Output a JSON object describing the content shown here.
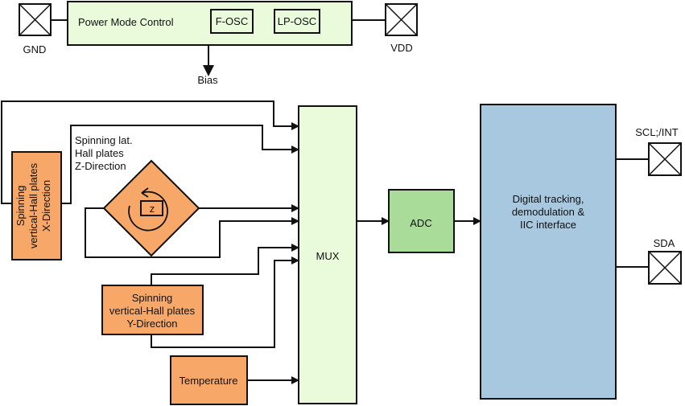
{
  "colors": {
    "power_block": "#eafbdc",
    "sensor_block": "#f7a868",
    "mux_block": "#eafbdc",
    "adc_block": "#a9dc98",
    "digital_block": "#a8c8e0",
    "line": "#111111"
  },
  "power": {
    "title": "Power Mode Control",
    "fosc": "F-OSC",
    "lposc": "LP-OSC",
    "bias": "Bias"
  },
  "pins": {
    "gnd": "GND",
    "vdd": "VDD",
    "scl": "SCL;/INT",
    "sda": "SDA"
  },
  "sensors": {
    "x_direction": [
      "Spinning",
      "vertical-Hall plates",
      "X-Direction"
    ],
    "z_direction_label": [
      "Spinning lat.",
      "Hall plates",
      "Z-Direction"
    ],
    "z_symbol": "z",
    "y_direction": [
      "Spinning",
      "vertical-Hall plates",
      "Y-Direction"
    ],
    "temperature": "Temperature"
  },
  "mux": {
    "label": "MUX"
  },
  "adc": {
    "label": "ADC"
  },
  "digital": {
    "label": [
      "Digital tracking,",
      "demodulation &",
      "IIC interface"
    ]
  }
}
